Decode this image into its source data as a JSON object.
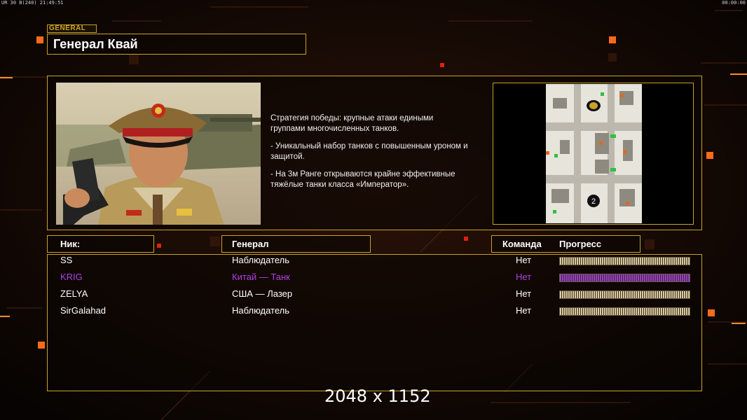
{
  "hud": {
    "left_status": "UR 30 B(240) 21:49:51",
    "right_timer": "00:00:00"
  },
  "general_tag": "GENERAL",
  "title": "Генерал Квай",
  "description": [
    "Стратегия победы: крупные атаки едиными\n группами многочисленных танков.",
    "- Уникальный набор танков с повышенным уроном и\n защитой.",
    "- На 3м Ранге открываются крайне эффективные\n тяжёлые танки класса «Император»."
  ],
  "map": {
    "start_marker": "2"
  },
  "table": {
    "headers": {
      "nick": "Ник:",
      "general": "Генерал",
      "team": "Команда",
      "progress": "Прогресс"
    },
    "rows": [
      {
        "nick": "SS",
        "general": "Наблюдатель",
        "team": "Нет",
        "color": "#ffffff",
        "bar_color": "#d8c9a0",
        "progress": 1.0
      },
      {
        "nick": "KRIG",
        "general": "Китай — Танк",
        "team": "Нет",
        "color": "#b040e0",
        "bar_color": "#9a3ad0",
        "progress": 1.0
      },
      {
        "nick": "ZELYA",
        "general": "США — Лазер",
        "team": "Нет",
        "color": "#ffffff",
        "bar_color": "#d8c9a0",
        "progress": 1.0
      },
      {
        "nick": "SirGalahad",
        "general": "Наблюдатель",
        "team": "Нет",
        "color": "#ffffff",
        "bar_color": "#d8c9a0",
        "progress": 1.0
      }
    ]
  },
  "watermark": "2048 x 1152",
  "colors": {
    "frame": "#c9a227",
    "accent_orange": "#ff6a1a",
    "background": "#080403"
  }
}
